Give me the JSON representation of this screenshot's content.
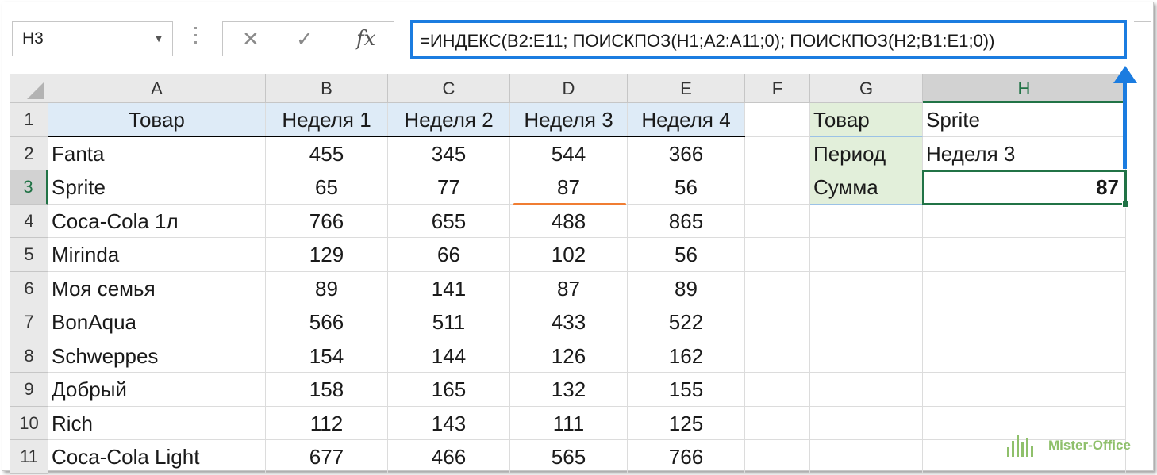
{
  "formula_bar": {
    "name_box": "H3",
    "cancel_icon": "✕",
    "enter_icon": "✓",
    "fx_label": "fx",
    "formula": "=ИНДЕКС(B2:E11; ПОИСКПОЗ(H1;A2:A11;0); ПОИСКПОЗ(H2;B1:E1;0))"
  },
  "columns": [
    "A",
    "B",
    "C",
    "D",
    "E",
    "F",
    "G",
    "H"
  ],
  "rows": [
    "1",
    "2",
    "3",
    "4",
    "5",
    "6",
    "7",
    "8",
    "9",
    "10",
    "11"
  ],
  "table": {
    "headers": [
      "Товар",
      "Неделя 1",
      "Неделя 2",
      "Неделя 3",
      "Неделя 4"
    ],
    "data": [
      [
        "Fanta",
        "455",
        "345",
        "544",
        "366"
      ],
      [
        "Sprite",
        "65",
        "77",
        "87",
        "56"
      ],
      [
        "Coca-Cola 1л",
        "766",
        "655",
        "488",
        "865"
      ],
      [
        "Mirinda",
        "129",
        "66",
        "102",
        "56"
      ],
      [
        "Моя семья",
        "89",
        "141",
        "87",
        "89"
      ],
      [
        "BonAqua",
        "566",
        "511",
        "433",
        "522"
      ],
      [
        "Schweppes",
        "154",
        "144",
        "126",
        "162"
      ],
      [
        "Добрый",
        "158",
        "165",
        "132",
        "155"
      ],
      [
        "Rich",
        "112",
        "143",
        "111",
        "125"
      ],
      [
        "Coca-Cola Light",
        "677",
        "466",
        "565",
        "766"
      ]
    ]
  },
  "lookup": {
    "g1": "Товар",
    "h1": "Sprite",
    "g2": "Период",
    "h2": "Неделя 3",
    "g3": "Сумма",
    "h3": "87"
  },
  "selected_cell": "H3",
  "watermark": "Mister-Office",
  "colors": {
    "accent_blue": "#1b7ce0",
    "excel_green": "#217346",
    "underline_orange": "#f07d33"
  }
}
